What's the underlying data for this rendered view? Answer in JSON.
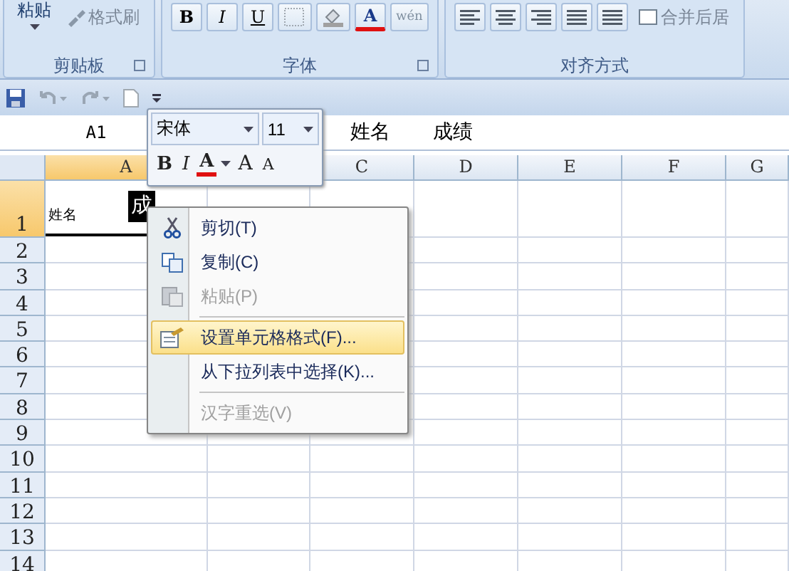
{
  "ribbon": {
    "groups": [
      {
        "label": "剪贴板",
        "buttons": [
          {
            "kind": "paste",
            "label": "粘贴"
          },
          {
            "kind": "brush",
            "label": "格式刷"
          }
        ]
      },
      {
        "label": "字体",
        "buttons": [
          {
            "kind": "bold",
            "label": "B"
          },
          {
            "kind": "italic",
            "label": "I"
          },
          {
            "kind": "underline",
            "label": "U"
          },
          {
            "kind": "border"
          },
          {
            "kind": "fill"
          },
          {
            "kind": "fontcolor",
            "label": "A"
          },
          {
            "kind": "phonetic",
            "label": "wén"
          }
        ]
      },
      {
        "label": "对齐方式",
        "buttons": [
          {
            "kind": "alignleft"
          },
          {
            "kind": "aligncenter"
          },
          {
            "kind": "alignright"
          },
          {
            "kind": "outdent"
          },
          {
            "kind": "indent"
          },
          {
            "kind": "merge",
            "label": "合并后居"
          }
        ]
      }
    ]
  },
  "quick_access": [
    {
      "kind": "save"
    },
    {
      "kind": "undo"
    },
    {
      "kind": "redo"
    },
    {
      "kind": "new"
    },
    {
      "kind": "customize"
    }
  ],
  "formula_bar": {
    "name_box": "A1",
    "content": [
      "姓名",
      "成绩"
    ]
  },
  "columns": [
    {
      "label": "A",
      "selected": true
    },
    {
      "label": "C",
      "selected": false
    },
    {
      "label": "D",
      "selected": false
    },
    {
      "label": "E",
      "selected": false
    },
    {
      "label": "F",
      "selected": false
    },
    {
      "label": "G",
      "selected": false
    }
  ],
  "rows": [
    {
      "label": "1",
      "selected": true
    },
    {
      "label": "2",
      "selected": false
    },
    {
      "label": "3",
      "selected": false
    },
    {
      "label": "4",
      "selected": false
    },
    {
      "label": "5",
      "selected": false
    },
    {
      "label": "6",
      "selected": false
    },
    {
      "label": "7",
      "selected": false
    },
    {
      "label": "8",
      "selected": false
    },
    {
      "label": "9",
      "selected": false
    },
    {
      "label": "10",
      "selected": false
    },
    {
      "label": "11",
      "selected": false
    },
    {
      "label": "12",
      "selected": false
    },
    {
      "label": "13",
      "selected": false
    },
    {
      "label": "14",
      "selected": false
    }
  ],
  "cell_a1": {
    "text": "姓名",
    "selected_text": "成"
  },
  "mini_toolbar": {
    "font": "宋体",
    "size": "11",
    "buttons": [
      {
        "kind": "bold",
        "label": "B"
      },
      {
        "kind": "italic",
        "label": "I"
      },
      {
        "kind": "fontcolor",
        "label": "A"
      },
      {
        "kind": "grow",
        "label": "A"
      },
      {
        "kind": "shrink",
        "label": "A"
      }
    ]
  },
  "context_menu": [
    {
      "kind": "cut",
      "label": "剪切(T)",
      "disabled": false,
      "selected": false
    },
    {
      "kind": "copy",
      "label": "复制(C)",
      "disabled": false,
      "selected": false
    },
    {
      "kind": "paste",
      "label": "粘贴(P)",
      "disabled": true,
      "selected": false
    },
    {
      "kind": "separator"
    },
    {
      "kind": "format",
      "label": "设置单元格格式(F)...",
      "disabled": false,
      "selected": true
    },
    {
      "kind": "plain",
      "label": "从下拉列表中选择(K)...",
      "disabled": false,
      "selected": false
    },
    {
      "kind": "separator"
    },
    {
      "kind": "plain",
      "label": "汉字重选(V)",
      "disabled": true,
      "selected": false
    }
  ]
}
